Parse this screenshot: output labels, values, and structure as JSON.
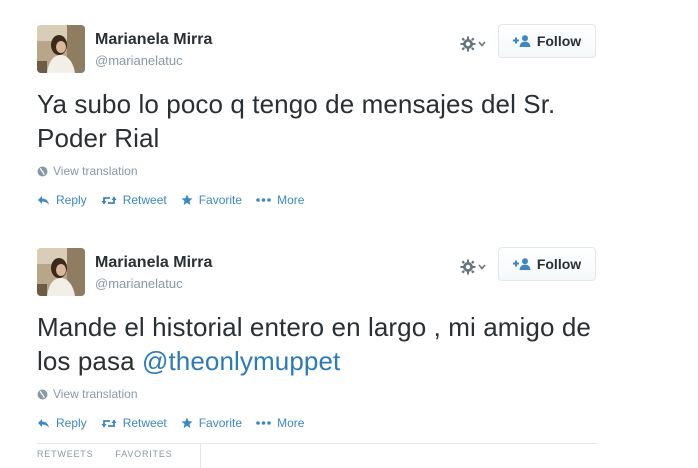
{
  "tweets": [
    {
      "fullname": "Marianela Mirra",
      "username": "@marianelatuc",
      "follow_label": "Follow",
      "text": "Ya subo lo poco q tengo de mensajes del Sr. Poder Rial",
      "mention": "",
      "translate_label": "View translation",
      "actions": {
        "reply": "Reply",
        "retweet": "Retweet",
        "favorite": "Favorite",
        "more": "More"
      }
    },
    {
      "fullname": "Marianela Mirra",
      "username": "@marianelatuc",
      "follow_label": "Follow",
      "text": "Mande el historial entero en largo , mi amigo de los pasa ",
      "mention": "@theonlymuppet",
      "translate_label": "View translation",
      "actions": {
        "reply": "Reply",
        "retweet": "Retweet",
        "favorite": "Favorite",
        "more": "More"
      }
    }
  ],
  "stats": {
    "retweets_label": "RETWEETS",
    "favorites_label": "FAVORITES"
  },
  "colors": {
    "link": "#3b88c3",
    "mention": "#2b7bb9",
    "text": "#292f33",
    "muted": "#8899a6"
  }
}
